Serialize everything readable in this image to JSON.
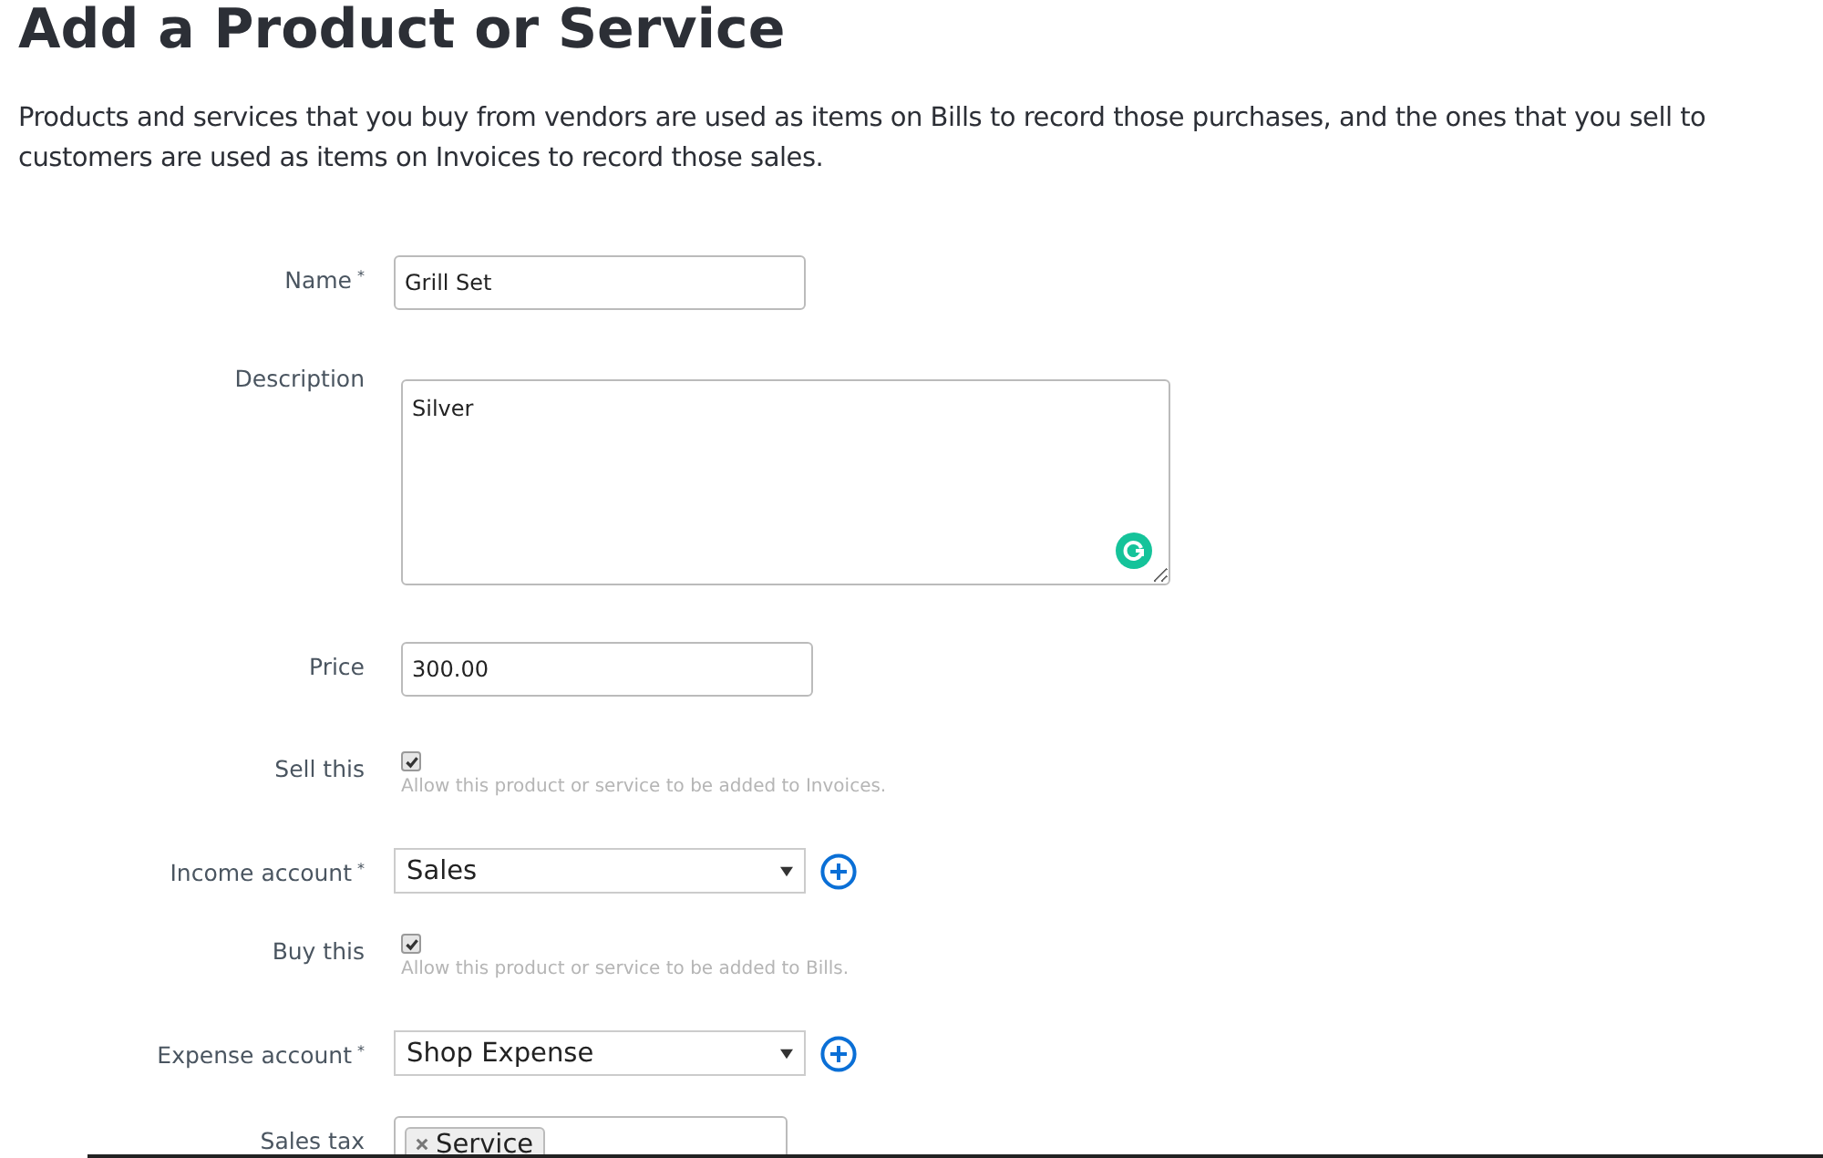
{
  "title": "Add a Product or Service",
  "intro": "Products and services that you buy from vendors are used as items on Bills to record those purchases, and the ones that you sell to customers are used as items on Invoices to record those sales.",
  "fields": [
    {
      "kind": "text",
      "label": "Name",
      "required_mark": "*",
      "value": "Grill Set"
    },
    {
      "kind": "textarea",
      "label": "Description",
      "value": "Silver"
    },
    {
      "kind": "text",
      "label": "Price",
      "value": "300.00"
    },
    {
      "kind": "checkbox",
      "label": "Sell this",
      "checked": true,
      "hint": "Allow this product or service to be added to Invoices."
    },
    {
      "kind": "select",
      "label": "Income account",
      "required_mark": "*",
      "value": "Sales"
    },
    {
      "kind": "checkbox",
      "label": "Buy this",
      "checked": true,
      "hint": "Allow this product or service to be added to Bills."
    },
    {
      "kind": "select",
      "label": "Expense account",
      "required_mark": "*",
      "value": "Shop Expense"
    },
    {
      "kind": "tags",
      "label": "Sales tax",
      "tags": [
        "Service"
      ]
    }
  ]
}
